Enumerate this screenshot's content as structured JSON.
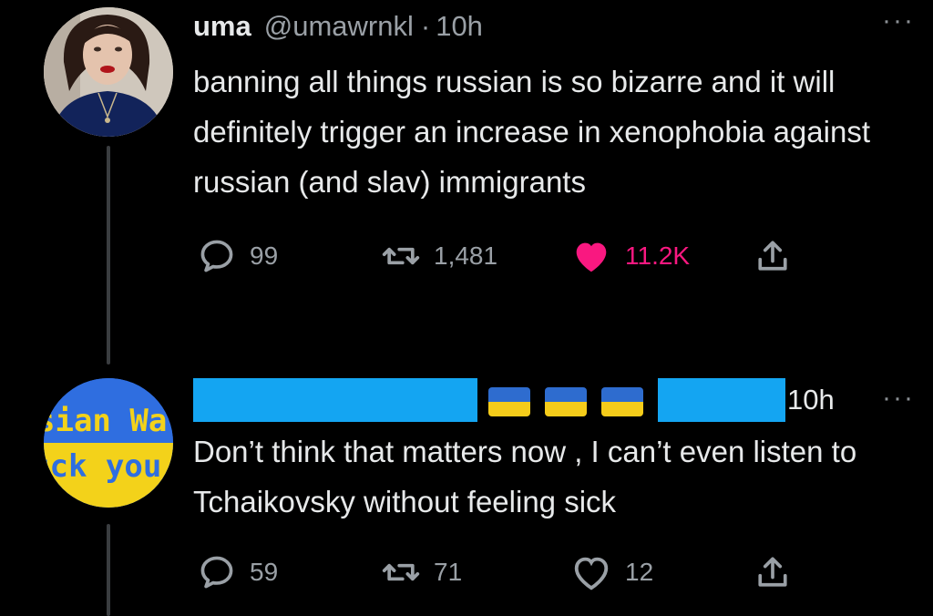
{
  "tweet1": {
    "display_name": "uma",
    "handle": "@umawrnkl",
    "separator": "·",
    "time": "10h",
    "more_icon": "···",
    "text": "banning all things russian is so bizarre and it will definitely trigger an increase in xenophobia against russian (and slav) immigrants",
    "replies": "99",
    "retweets": "1,481",
    "likes": "11.2K",
    "liked": true
  },
  "tweet2": {
    "time": "10h",
    "more_icon": "···",
    "avatar_text_line1": "sian Wa",
    "avatar_text_line2": "uck you",
    "text": "Don’t think that matters now , I can’t even listen to Tchaikovsky without feeling sick",
    "replies": "59",
    "retweets": "71",
    "likes": "12",
    "liked": false
  },
  "colors": {
    "like_active": "#f91880",
    "redaction": "#14a5f2",
    "flag_blue": "#2e6ccf",
    "flag_yellow": "#f5cc1a",
    "muted": "#9aa0a6"
  },
  "icons": [
    "reply-icon",
    "retweet-icon",
    "heart-icon",
    "share-icon",
    "more-icon",
    "ukraine-flag-emoji"
  ]
}
